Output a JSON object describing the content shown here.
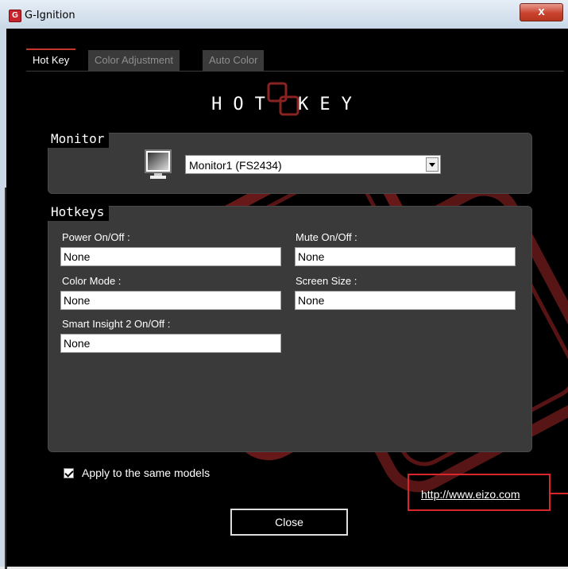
{
  "window": {
    "title": "G-Ignition",
    "close_label": "x"
  },
  "tabs": [
    {
      "label": "Hot Key",
      "active": true
    },
    {
      "label": "Color Adjustment",
      "active": false
    },
    {
      "label": "Auto Color",
      "active": false
    }
  ],
  "heading": "HOT KEY",
  "monitor": {
    "legend": "Monitor",
    "selected": "Monitor1 (FS2434)"
  },
  "hotkeys": {
    "legend": "Hotkeys",
    "fields": [
      {
        "label": "Power On/Off :",
        "value": "None"
      },
      {
        "label": "Mute On/Off :",
        "value": "None"
      },
      {
        "label": "Color Mode :",
        "value": "None"
      },
      {
        "label": "Screen Size :",
        "value": "None"
      },
      {
        "label": "Smart Insight 2 On/Off :",
        "value": "None"
      }
    ]
  },
  "apply": {
    "label": "Apply to the same models",
    "checked": true
  },
  "link": {
    "text": "http://www.eizo.com"
  },
  "close_button": {
    "label": "Close"
  },
  "colors": {
    "accent": "#c2362b",
    "highlight_box": "#d9262d",
    "panel": "#3a3a3a"
  }
}
